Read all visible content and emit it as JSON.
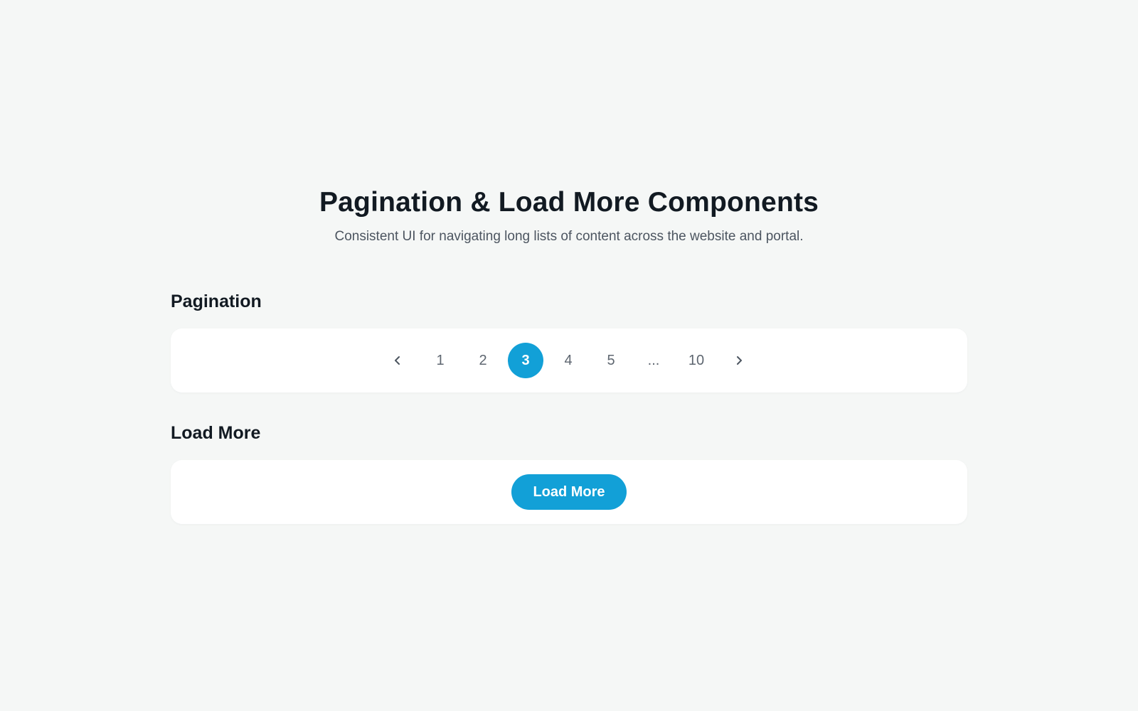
{
  "header": {
    "title": "Pagination & Load More Components",
    "subtitle": "Consistent UI for navigating long lists of content across the website and portal."
  },
  "pagination_section": {
    "title": "Pagination",
    "prev_icon": "chevron-left-icon",
    "next_icon": "chevron-right-icon",
    "pages": [
      "1",
      "2",
      "3",
      "4",
      "5"
    ],
    "ellipsis": "...",
    "last_page": "10",
    "current_page": "3"
  },
  "load_more_section": {
    "title": "Load More",
    "button_label": "Load More"
  },
  "colors": {
    "accent": "#12a0d7",
    "background": "#f5f7f6",
    "card": "#ffffff",
    "text_primary": "#121a22",
    "text_secondary": "#4c5560"
  }
}
